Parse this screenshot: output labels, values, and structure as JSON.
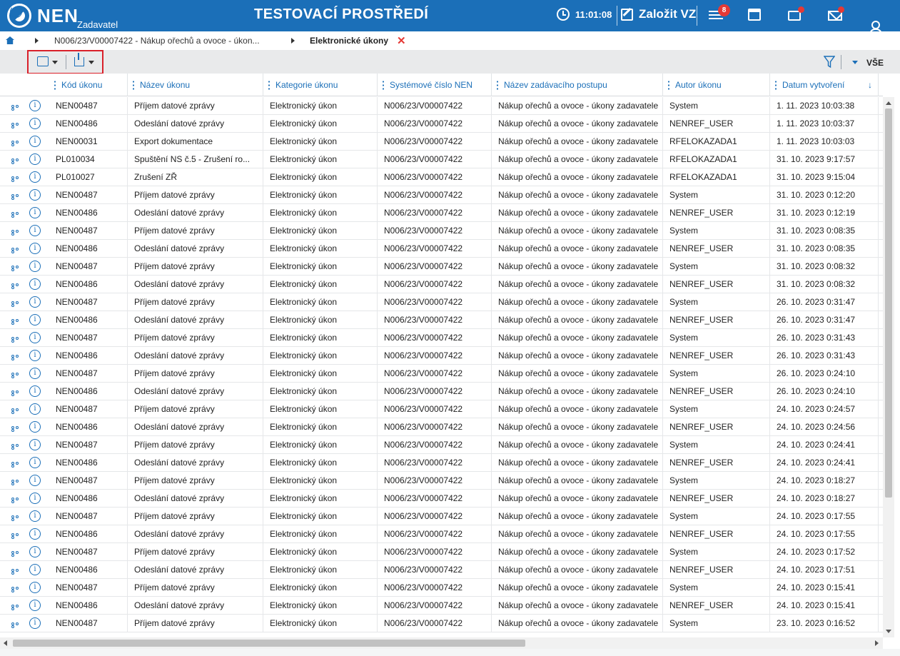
{
  "header": {
    "logo_text": "NEN",
    "logo_sub": "Zadavatel",
    "env_title": "TESTOVACÍ PROSTŘEDÍ",
    "time": "11:01:08",
    "create_label": "Založit VZ",
    "notification_count": "8",
    "brand_color": "#1b6fb8",
    "alert_color": "#e53935"
  },
  "breadcrumb": {
    "items": [
      {
        "label": "N006/23/V00007422 - Nákup ořechů a ovoce - úkon..."
      },
      {
        "label": "Elektronické úkony"
      }
    ]
  },
  "toolbar": {
    "filter_label": "VŠE"
  },
  "grid": {
    "columns": [
      {
        "label": "Kód úkonu"
      },
      {
        "label": "Název úkonu"
      },
      {
        "label": "Kategorie úkonu"
      },
      {
        "label": "Systémové číslo NEN"
      },
      {
        "label": "Název zadávacího postupu"
      },
      {
        "label": "Autor úkonu"
      },
      {
        "label": "Datum vytvoření",
        "sort_arrow": "↓"
      }
    ],
    "rows": [
      [
        "NEN00487",
        "Příjem datové zprávy",
        "Elektronický úkon",
        "N006/23/V00007422",
        "Nákup ořechů a ovoce - úkony zadavatele",
        "System",
        "1. 11. 2023 10:03:38"
      ],
      [
        "NEN00486",
        "Odeslání datové zprávy",
        "Elektronický úkon",
        "N006/23/V00007422",
        "Nákup ořechů a ovoce - úkony zadavatele",
        "NENREF_USER",
        "1. 11. 2023 10:03:37"
      ],
      [
        "NEN00031",
        "Export dokumentace",
        "Elektronický úkon",
        "N006/23/V00007422",
        "Nákup ořechů a ovoce - úkony zadavatele",
        "RFELOKAZADA1",
        "1. 11. 2023 10:03:03"
      ],
      [
        "PL010034",
        "Spuštění NS č.5 - Zrušení ro...",
        "Elektronický úkon",
        "N006/23/V00007422",
        "Nákup ořechů a ovoce - úkony zadavatele",
        "RFELOKAZADA1",
        "31. 10. 2023 9:17:57"
      ],
      [
        "PL010027",
        "Zrušení ZŘ",
        "Elektronický úkon",
        "N006/23/V00007422",
        "Nákup ořechů a ovoce - úkony zadavatele",
        "RFELOKAZADA1",
        "31. 10. 2023 9:15:04"
      ],
      [
        "NEN00487",
        "Příjem datové zprávy",
        "Elektronický úkon",
        "N006/23/V00007422",
        "Nákup ořechů a ovoce - úkony zadavatele",
        "System",
        "31. 10. 2023 0:12:20"
      ],
      [
        "NEN00486",
        "Odeslání datové zprávy",
        "Elektronický úkon",
        "N006/23/V00007422",
        "Nákup ořechů a ovoce - úkony zadavatele",
        "NENREF_USER",
        "31. 10. 2023 0:12:19"
      ],
      [
        "NEN00487",
        "Příjem datové zprávy",
        "Elektronický úkon",
        "N006/23/V00007422",
        "Nákup ořechů a ovoce - úkony zadavatele",
        "System",
        "31. 10. 2023 0:08:35"
      ],
      [
        "NEN00486",
        "Odeslání datové zprávy",
        "Elektronický úkon",
        "N006/23/V00007422",
        "Nákup ořechů a ovoce - úkony zadavatele",
        "NENREF_USER",
        "31. 10. 2023 0:08:35"
      ],
      [
        "NEN00487",
        "Příjem datové zprávy",
        "Elektronický úkon",
        "N006/23/V00007422",
        "Nákup ořechů a ovoce - úkony zadavatele",
        "System",
        "31. 10. 2023 0:08:32"
      ],
      [
        "NEN00486",
        "Odeslání datové zprávy",
        "Elektronický úkon",
        "N006/23/V00007422",
        "Nákup ořechů a ovoce - úkony zadavatele",
        "NENREF_USER",
        "31. 10. 2023 0:08:32"
      ],
      [
        "NEN00487",
        "Příjem datové zprávy",
        "Elektronický úkon",
        "N006/23/V00007422",
        "Nákup ořechů a ovoce - úkony zadavatele",
        "System",
        "26. 10. 2023 0:31:47"
      ],
      [
        "NEN00486",
        "Odeslání datové zprávy",
        "Elektronický úkon",
        "N006/23/V00007422",
        "Nákup ořechů a ovoce - úkony zadavatele",
        "NENREF_USER",
        "26. 10. 2023 0:31:47"
      ],
      [
        "NEN00487",
        "Příjem datové zprávy",
        "Elektronický úkon",
        "N006/23/V00007422",
        "Nákup ořechů a ovoce - úkony zadavatele",
        "System",
        "26. 10. 2023 0:31:43"
      ],
      [
        "NEN00486",
        "Odeslání datové zprávy",
        "Elektronický úkon",
        "N006/23/V00007422",
        "Nákup ořechů a ovoce - úkony zadavatele",
        "NENREF_USER",
        "26. 10. 2023 0:31:43"
      ],
      [
        "NEN00487",
        "Příjem datové zprávy",
        "Elektronický úkon",
        "N006/23/V00007422",
        "Nákup ořechů a ovoce - úkony zadavatele",
        "System",
        "26. 10. 2023 0:24:10"
      ],
      [
        "NEN00486",
        "Odeslání datové zprávy",
        "Elektronický úkon",
        "N006/23/V00007422",
        "Nákup ořechů a ovoce - úkony zadavatele",
        "NENREF_USER",
        "26. 10. 2023 0:24:10"
      ],
      [
        "NEN00487",
        "Příjem datové zprávy",
        "Elektronický úkon",
        "N006/23/V00007422",
        "Nákup ořechů a ovoce - úkony zadavatele",
        "System",
        "24. 10. 2023 0:24:57"
      ],
      [
        "NEN00486",
        "Odeslání datové zprávy",
        "Elektronický úkon",
        "N006/23/V00007422",
        "Nákup ořechů a ovoce - úkony zadavatele",
        "NENREF_USER",
        "24. 10. 2023 0:24:56"
      ],
      [
        "NEN00487",
        "Příjem datové zprávy",
        "Elektronický úkon",
        "N006/23/V00007422",
        "Nákup ořechů a ovoce - úkony zadavatele",
        "System",
        "24. 10. 2023 0:24:41"
      ],
      [
        "NEN00486",
        "Odeslání datové zprávy",
        "Elektronický úkon",
        "N006/23/V00007422",
        "Nákup ořechů a ovoce - úkony zadavatele",
        "NENREF_USER",
        "24. 10. 2023 0:24:41"
      ],
      [
        "NEN00487",
        "Příjem datové zprávy",
        "Elektronický úkon",
        "N006/23/V00007422",
        "Nákup ořechů a ovoce - úkony zadavatele",
        "System",
        "24. 10. 2023 0:18:27"
      ],
      [
        "NEN00486",
        "Odeslání datové zprávy",
        "Elektronický úkon",
        "N006/23/V00007422",
        "Nákup ořechů a ovoce - úkony zadavatele",
        "NENREF_USER",
        "24. 10. 2023 0:18:27"
      ],
      [
        "NEN00487",
        "Příjem datové zprávy",
        "Elektronický úkon",
        "N006/23/V00007422",
        "Nákup ořechů a ovoce - úkony zadavatele",
        "System",
        "24. 10. 2023 0:17:55"
      ],
      [
        "NEN00486",
        "Odeslání datové zprávy",
        "Elektronický úkon",
        "N006/23/V00007422",
        "Nákup ořechů a ovoce - úkony zadavatele",
        "NENREF_USER",
        "24. 10. 2023 0:17:55"
      ],
      [
        "NEN00487",
        "Příjem datové zprávy",
        "Elektronický úkon",
        "N006/23/V00007422",
        "Nákup ořechů a ovoce - úkony zadavatele",
        "System",
        "24. 10. 2023 0:17:52"
      ],
      [
        "NEN00486",
        "Odeslání datové zprávy",
        "Elektronický úkon",
        "N006/23/V00007422",
        "Nákup ořechů a ovoce - úkony zadavatele",
        "NENREF_USER",
        "24. 10. 2023 0:17:51"
      ],
      [
        "NEN00487",
        "Příjem datové zprávy",
        "Elektronický úkon",
        "N006/23/V00007422",
        "Nákup ořechů a ovoce - úkony zadavatele",
        "System",
        "24. 10. 2023 0:15:41"
      ],
      [
        "NEN00486",
        "Odeslání datové zprávy",
        "Elektronický úkon",
        "N006/23/V00007422",
        "Nákup ořechů a ovoce - úkony zadavatele",
        "NENREF_USER",
        "24. 10. 2023 0:15:41"
      ],
      [
        "NEN00487",
        "Příjem datové zprávy",
        "Elektronický úkon",
        "N006/23/V00007422",
        "Nákup ořechů a ovoce - úkony zadavatele",
        "System",
        "23. 10. 2023 0:16:52"
      ]
    ]
  }
}
